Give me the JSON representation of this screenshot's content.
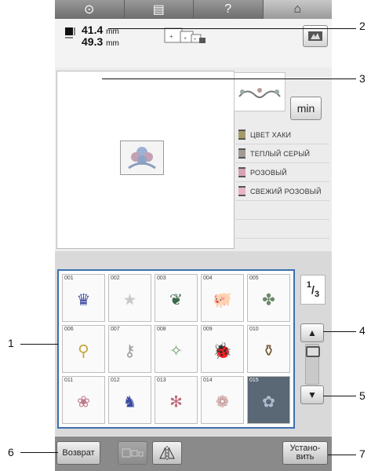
{
  "topbar": {
    "tabs": [
      {
        "name": "clock-icon",
        "glyph": "⊙"
      },
      {
        "name": "document-icon",
        "glyph": "▤"
      },
      {
        "name": "help-icon",
        "glyph": "?"
      },
      {
        "name": "home-icon",
        "glyph": "⌂"
      }
    ]
  },
  "size": {
    "width_value": "41.4",
    "height_value": "49.3",
    "unit": "mm"
  },
  "preview": {
    "min_label": "min"
  },
  "thread_colors": [
    {
      "name": "ЦВЕТ ХАКИ"
    },
    {
      "name": "ТЕПЛЫЙ СЕРЫЙ"
    },
    {
      "name": "РОЗОВЫЙ"
    },
    {
      "name": "СВЕЖИЙ РОЗОВЫЙ"
    }
  ],
  "patterns": [
    {
      "num": "001",
      "icon": "crown-icon",
      "glyph": "♛",
      "color": "#3a4aa0"
    },
    {
      "num": "002",
      "icon": "star-icon",
      "glyph": "★",
      "color": "#c9c9c9"
    },
    {
      "num": "003",
      "icon": "leaf-icon",
      "glyph": "❦",
      "color": "#3e6a4a"
    },
    {
      "num": "004",
      "icon": "pig-icon",
      "glyph": "🐖",
      "color": "#c88"
    },
    {
      "num": "005",
      "icon": "clover-icon",
      "glyph": "✤",
      "color": "#6a8a6a"
    },
    {
      "num": "006",
      "icon": "pin-icon",
      "glyph": "⚲",
      "color": "#c6a640"
    },
    {
      "num": "007",
      "icon": "key-icon",
      "glyph": "⚷",
      "color": "#999"
    },
    {
      "num": "008",
      "icon": "bird-icon",
      "glyph": "✧",
      "color": "#6fa06f"
    },
    {
      "num": "009",
      "icon": "ladybug-icon",
      "glyph": "🐞",
      "color": "#222"
    },
    {
      "num": "010",
      "icon": "pot-icon",
      "glyph": "⚱",
      "color": "#7a5a3a"
    },
    {
      "num": "011",
      "icon": "ornament-icon",
      "glyph": "❀",
      "color": "#c07a8a"
    },
    {
      "num": "012",
      "icon": "dragon-icon",
      "glyph": "♞",
      "color": "#3a4aa0"
    },
    {
      "num": "013",
      "icon": "snowflake-icon",
      "glyph": "✻",
      "color": "#c06a7a"
    },
    {
      "num": "014",
      "icon": "rosette-icon",
      "glyph": "❁",
      "color": "#b88"
    },
    {
      "num": "015",
      "icon": "flower-icon",
      "glyph": "✿",
      "color": "#aebbd0"
    }
  ],
  "pagination": {
    "current": "1",
    "total": "3"
  },
  "bottom": {
    "back_label": "Возврат",
    "set_label_line1": "Устано-",
    "set_label_line2": "вить"
  },
  "callouts": [
    "1",
    "2",
    "3",
    "4",
    "5",
    "6",
    "7"
  ]
}
